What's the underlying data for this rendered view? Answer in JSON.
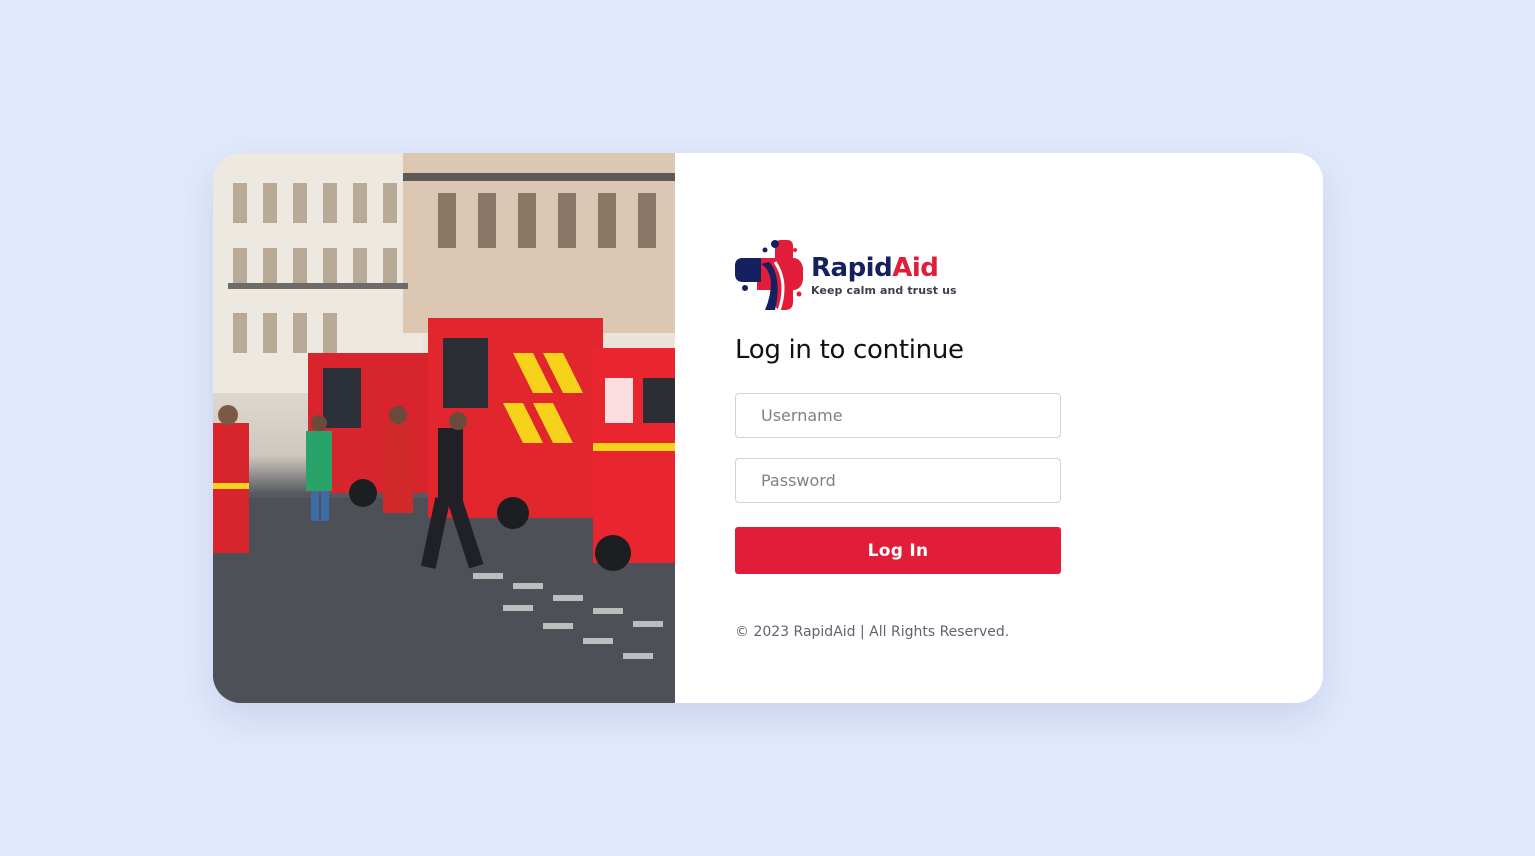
{
  "brand": {
    "name_part1": "Rapid",
    "name_part2": "Aid",
    "tagline": "Keep calm and trust us",
    "logo_icon": "medical-cross-person-icon",
    "colors": {
      "navy": "#15205f",
      "red": "#e11d3a"
    }
  },
  "login": {
    "heading": "Log in to continue",
    "username_placeholder": "Username",
    "password_placeholder": "Password",
    "submit_label": "Log In"
  },
  "footer": {
    "copyright": "© 2023 RapidAid | All Rights Reserved."
  },
  "theme": {
    "page_background": "#e1e9fc",
    "card_background": "#ffffff",
    "accent": "#e11d3a"
  }
}
